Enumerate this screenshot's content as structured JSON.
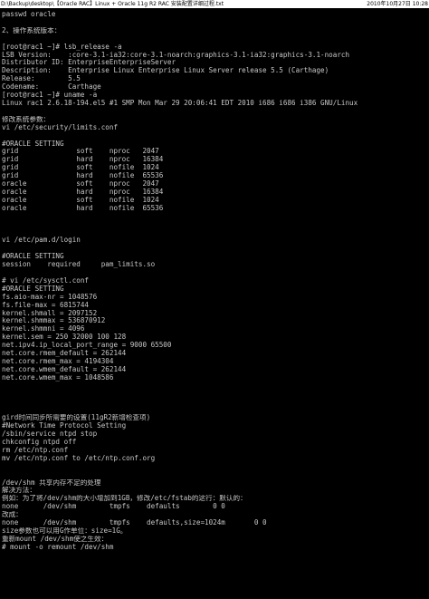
{
  "header": {
    "path": "D:\\Backup\\desktop\\【Oracle RAC】Linux + Oracle 11g R2 RAC 安装配置详细过程.txt",
    "page_info": "2010年10月27日 10:28"
  },
  "lines": [
    "passwd oracle",
    "",
    "2、操作系统版本：",
    "",
    "[root@rac1 ~]# lsb_release -a",
    "LSB Version:    :core-3.1-ia32:core-3.1-noarch:graphics-3.1-ia32:graphics-3.1-noarch",
    "Distributor ID: EnterpriseEnterpriseServer",
    "Description:    Enterprise Linux Enterprise Linux Server release 5.5 (Carthage)",
    "Release:        5.5",
    "Codename:       Carthage",
    "[root@rac1 ~]# uname -a",
    "Linux rac1 2.6.18-194.el5 #1 SMP Mon Mar 29 20:06:41 EDT 2010 i686 i686 i386 GNU/Linux",
    "",
    "修改系统参数：",
    "vi /etc/security/limits.conf",
    "",
    "#ORACLE SETTING",
    "grid              soft    nproc   2047",
    "grid              hard    nproc   16384",
    "grid              soft    nofile  1024",
    "grid              hard    nofile  65536",
    "oracle            soft    nproc   2047",
    "oracle            hard    nproc   16384",
    "oracle            soft    nofile  1024",
    "oracle            hard    nofile  65536",
    "",
    "",
    "",
    "vi /etc/pam.d/login",
    "",
    "#ORACLE SETTING",
    "session    required     pam_limits.so",
    "",
    "# vi /etc/sysctl.conf",
    "#ORACLE SETTING",
    "fs.aio-max-nr = 1048576",
    "fs.file-max = 6815744",
    "kernel.shmall = 2097152",
    "kernel.shmmax = 536870912",
    "kernel.shmmni = 4096",
    "kernel.sem = 250 32000 100 128",
    "net.ipv4.ip_local_port_range = 9000 65500",
    "net.core.rmem_default = 262144",
    "net.core.rmem_max = 4194304",
    "net.core.wmem_default = 262144",
    "net.core.wmem_max = 1048586",
    "",
    "",
    "",
    "",
    "gird时间同步所需要的设置(11gR2新增检查项)",
    "#Network Time Protocol Setting",
    "/sbin/service ntpd stop",
    "chkconfig ntpd off",
    "rm /etc/ntp.conf",
    "mv /etc/ntp.conf to /etc/ntp.conf.org",
    "",
    "",
    "/dev/shm 共享内存不足的处理",
    "解决方法：",
    "例如：为了将/dev/shm的大小增加到1GB，修改/etc/fstab的这行：默认的：",
    "none      /dev/shm        tmpfs    defaults        0 0",
    "改成：",
    "none      /dev/shm        tmpfs    defaults,size=1024m       0 0",
    "size参数也可以用G作单位：size=1G。",
    "重新mount /dev/shm使之生效：",
    "# mount -o remount /dev/shm"
  ]
}
